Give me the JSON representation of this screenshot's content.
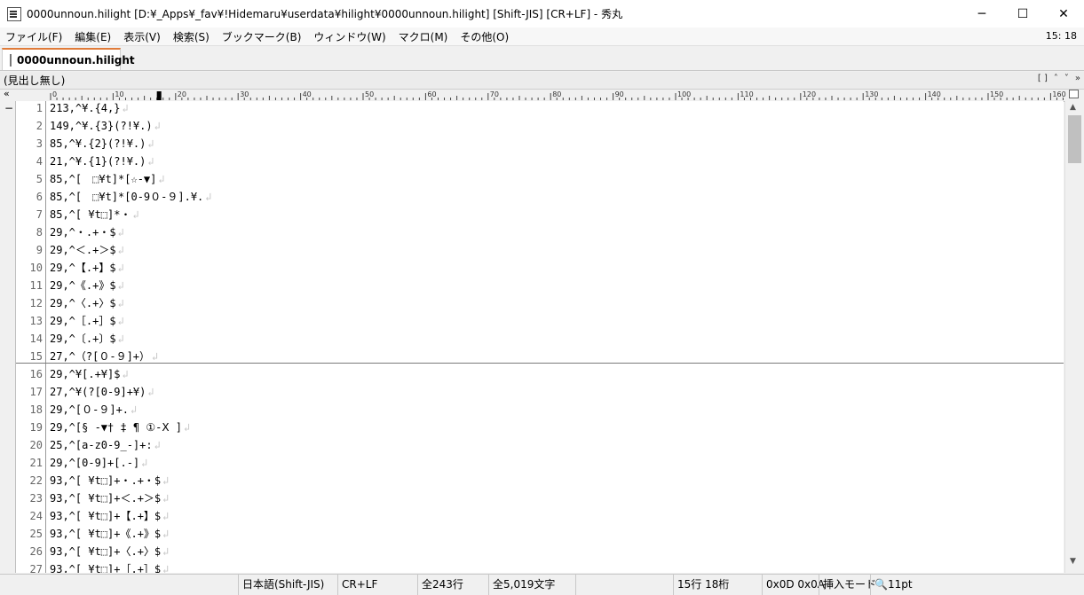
{
  "window": {
    "title": "0000unnoun.hilight [D:¥_Apps¥_fav¥!Hidemaru¥userdata¥hilight¥0000unnoun.hilight] [Shift-JIS] [CR+LF] - 秀丸",
    "minimize": "─",
    "maximize": "☐",
    "close": "✕"
  },
  "menu": {
    "items": [
      "ファイル(F)",
      "編集(E)",
      "表示(V)",
      "検索(S)",
      "ブックマーク(B)",
      "ウィンドウ(W)",
      "マクロ(M)",
      "その他(O)"
    ],
    "clock": "15: 18"
  },
  "tabs": [
    {
      "label": "0000unnoun.hilight"
    }
  ],
  "outline": {
    "label": "(見出し無し)",
    "controls": [
      "[ ]",
      "˄",
      "˅",
      "»"
    ]
  },
  "ruler": {
    "collapse": "«",
    "marks": [
      "0",
      "10",
      "20",
      "30",
      "40",
      "50",
      "60",
      "70",
      "80",
      "90",
      "100",
      "110",
      "120",
      "130",
      "140",
      "150",
      "160"
    ],
    "cursor_column": 17
  },
  "gutter": {
    "fold_marker": "−"
  },
  "lines": [
    {
      "n": "1",
      "t": "213,^¥.{4,}"
    },
    {
      "n": "2",
      "t": "149,^¥.{3}(?!¥.)"
    },
    {
      "n": "3",
      "t": "85,^¥.{2}(?!¥.)"
    },
    {
      "n": "4",
      "t": "21,^¥.{1}(?!¥.)"
    },
    {
      "n": "5",
      "t": "85,^[　⬚¥t]*[☆-▼]"
    },
    {
      "n": "6",
      "t": "85,^[　⬚¥t]*[0-9０-９].¥."
    },
    {
      "n": "7",
      "t": "85,^[ ¥t⬚]*・"
    },
    {
      "n": "8",
      "t": "29,^・.+・$"
    },
    {
      "n": "9",
      "t": "29,^＜.+＞$"
    },
    {
      "n": "10",
      "t": "29,^【.+】$"
    },
    {
      "n": "11",
      "t": "29,^《.+》$"
    },
    {
      "n": "12",
      "t": "29,^〈.+〉$"
    },
    {
      "n": "13",
      "t": "29,^［.+］$"
    },
    {
      "n": "14",
      "t": "29,^〔.+〕$"
    },
    {
      "n": "15",
      "t": "27,^（?[０-９]+）"
    },
    {
      "n": "16",
      "t": "29,^¥[.+¥]$"
    },
    {
      "n": "17",
      "t": "27,^¥(?[0-9]+¥)"
    },
    {
      "n": "18",
      "t": "29,^[０-９]+."
    },
    {
      "n": "19",
      "t": "29,^[§ -▼† ‡ ¶ ①-Ⅹ ]"
    },
    {
      "n": "20",
      "t": "25,^[a-z0-9_-]+:"
    },
    {
      "n": "21",
      "t": "29,^[0-9]+[.-]"
    },
    {
      "n": "22",
      "t": "93,^[ ¥t⬚]+・.+・$"
    },
    {
      "n": "23",
      "t": "93,^[ ¥t⬚]+＜.+＞$"
    },
    {
      "n": "24",
      "t": "93,^[ ¥t⬚]+【.+】$"
    },
    {
      "n": "25",
      "t": "93,^[ ¥t⬚]+《.+》$"
    },
    {
      "n": "26",
      "t": "93,^[ ¥t⬚]+〈.+〉$"
    },
    {
      "n": "27",
      "t": "93,^[ ¥t⬚]+［.+］$"
    }
  ],
  "eol_glyph": "↲",
  "scrollbar": {
    "up": "▲",
    "down": "▼"
  },
  "status": {
    "encoding": "日本語(Shift-JIS)",
    "newline": "CR+LF",
    "total_lines": "全243行",
    "total_chars": "全5,019文字",
    "position": "15行 18桁",
    "char_code": "0x0D 0x0A",
    "mode": "挿入モード",
    "zoom": "🔍11pt"
  }
}
